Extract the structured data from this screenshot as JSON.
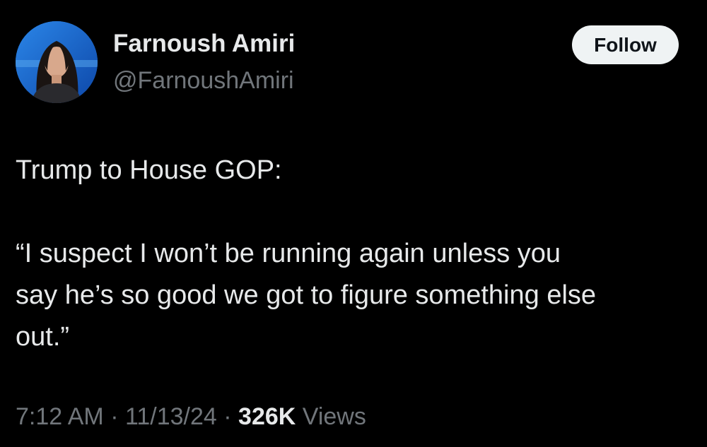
{
  "author": {
    "display_name": "Farnoush Amiri",
    "handle": "@FarnoushAmiri"
  },
  "follow_button": {
    "label": "Follow"
  },
  "tweet": {
    "line1": "Trump to House GOP:",
    "quote_lines": [
      "“I suspect I won’t be running again unless you",
      "say he’s so good we got to figure something else",
      "out.”"
    ]
  },
  "meta": {
    "time": "7:12 AM",
    "separator": "·",
    "date": "11/13/24",
    "views_count": "326K",
    "views_label": "Views"
  },
  "colors": {
    "background": "#000000",
    "primary_text": "#e7e9ea",
    "secondary_text": "#71767b",
    "button_bg": "#eff3f4",
    "button_text": "#0f1419"
  }
}
